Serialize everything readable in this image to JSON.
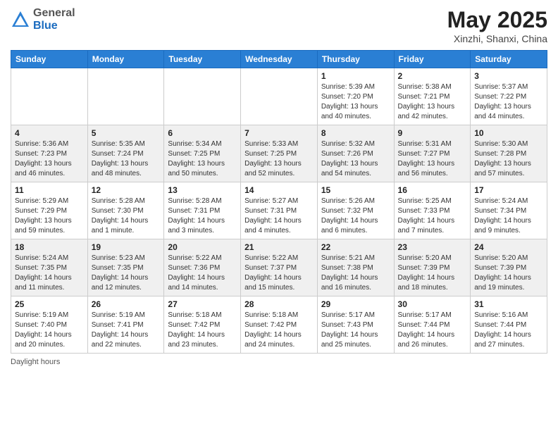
{
  "header": {
    "logo_general": "General",
    "logo_blue": "Blue",
    "title": "May 2025",
    "location": "Xinzhi, Shanxi, China"
  },
  "days_of_week": [
    "Sunday",
    "Monday",
    "Tuesday",
    "Wednesday",
    "Thursday",
    "Friday",
    "Saturday"
  ],
  "weeks": [
    [
      {
        "day": "",
        "info": ""
      },
      {
        "day": "",
        "info": ""
      },
      {
        "day": "",
        "info": ""
      },
      {
        "day": "",
        "info": ""
      },
      {
        "day": "1",
        "info": "Sunrise: 5:39 AM\nSunset: 7:20 PM\nDaylight: 13 hours\nand 40 minutes."
      },
      {
        "day": "2",
        "info": "Sunrise: 5:38 AM\nSunset: 7:21 PM\nDaylight: 13 hours\nand 42 minutes."
      },
      {
        "day": "3",
        "info": "Sunrise: 5:37 AM\nSunset: 7:22 PM\nDaylight: 13 hours\nand 44 minutes."
      }
    ],
    [
      {
        "day": "4",
        "info": "Sunrise: 5:36 AM\nSunset: 7:23 PM\nDaylight: 13 hours\nand 46 minutes."
      },
      {
        "day": "5",
        "info": "Sunrise: 5:35 AM\nSunset: 7:24 PM\nDaylight: 13 hours\nand 48 minutes."
      },
      {
        "day": "6",
        "info": "Sunrise: 5:34 AM\nSunset: 7:25 PM\nDaylight: 13 hours\nand 50 minutes."
      },
      {
        "day": "7",
        "info": "Sunrise: 5:33 AM\nSunset: 7:25 PM\nDaylight: 13 hours\nand 52 minutes."
      },
      {
        "day": "8",
        "info": "Sunrise: 5:32 AM\nSunset: 7:26 PM\nDaylight: 13 hours\nand 54 minutes."
      },
      {
        "day": "9",
        "info": "Sunrise: 5:31 AM\nSunset: 7:27 PM\nDaylight: 13 hours\nand 56 minutes."
      },
      {
        "day": "10",
        "info": "Sunrise: 5:30 AM\nSunset: 7:28 PM\nDaylight: 13 hours\nand 57 minutes."
      }
    ],
    [
      {
        "day": "11",
        "info": "Sunrise: 5:29 AM\nSunset: 7:29 PM\nDaylight: 13 hours\nand 59 minutes."
      },
      {
        "day": "12",
        "info": "Sunrise: 5:28 AM\nSunset: 7:30 PM\nDaylight: 14 hours\nand 1 minute."
      },
      {
        "day": "13",
        "info": "Sunrise: 5:28 AM\nSunset: 7:31 PM\nDaylight: 14 hours\nand 3 minutes."
      },
      {
        "day": "14",
        "info": "Sunrise: 5:27 AM\nSunset: 7:31 PM\nDaylight: 14 hours\nand 4 minutes."
      },
      {
        "day": "15",
        "info": "Sunrise: 5:26 AM\nSunset: 7:32 PM\nDaylight: 14 hours\nand 6 minutes."
      },
      {
        "day": "16",
        "info": "Sunrise: 5:25 AM\nSunset: 7:33 PM\nDaylight: 14 hours\nand 7 minutes."
      },
      {
        "day": "17",
        "info": "Sunrise: 5:24 AM\nSunset: 7:34 PM\nDaylight: 14 hours\nand 9 minutes."
      }
    ],
    [
      {
        "day": "18",
        "info": "Sunrise: 5:24 AM\nSunset: 7:35 PM\nDaylight: 14 hours\nand 11 minutes."
      },
      {
        "day": "19",
        "info": "Sunrise: 5:23 AM\nSunset: 7:35 PM\nDaylight: 14 hours\nand 12 minutes."
      },
      {
        "day": "20",
        "info": "Sunrise: 5:22 AM\nSunset: 7:36 PM\nDaylight: 14 hours\nand 14 minutes."
      },
      {
        "day": "21",
        "info": "Sunrise: 5:22 AM\nSunset: 7:37 PM\nDaylight: 14 hours\nand 15 minutes."
      },
      {
        "day": "22",
        "info": "Sunrise: 5:21 AM\nSunset: 7:38 PM\nDaylight: 14 hours\nand 16 minutes."
      },
      {
        "day": "23",
        "info": "Sunrise: 5:20 AM\nSunset: 7:39 PM\nDaylight: 14 hours\nand 18 minutes."
      },
      {
        "day": "24",
        "info": "Sunrise: 5:20 AM\nSunset: 7:39 PM\nDaylight: 14 hours\nand 19 minutes."
      }
    ],
    [
      {
        "day": "25",
        "info": "Sunrise: 5:19 AM\nSunset: 7:40 PM\nDaylight: 14 hours\nand 20 minutes."
      },
      {
        "day": "26",
        "info": "Sunrise: 5:19 AM\nSunset: 7:41 PM\nDaylight: 14 hours\nand 22 minutes."
      },
      {
        "day": "27",
        "info": "Sunrise: 5:18 AM\nSunset: 7:42 PM\nDaylight: 14 hours\nand 23 minutes."
      },
      {
        "day": "28",
        "info": "Sunrise: 5:18 AM\nSunset: 7:42 PM\nDaylight: 14 hours\nand 24 minutes."
      },
      {
        "day": "29",
        "info": "Sunrise: 5:17 AM\nSunset: 7:43 PM\nDaylight: 14 hours\nand 25 minutes."
      },
      {
        "day": "30",
        "info": "Sunrise: 5:17 AM\nSunset: 7:44 PM\nDaylight: 14 hours\nand 26 minutes."
      },
      {
        "day": "31",
        "info": "Sunrise: 5:16 AM\nSunset: 7:44 PM\nDaylight: 14 hours\nand 27 minutes."
      }
    ]
  ],
  "footer": "Daylight hours"
}
